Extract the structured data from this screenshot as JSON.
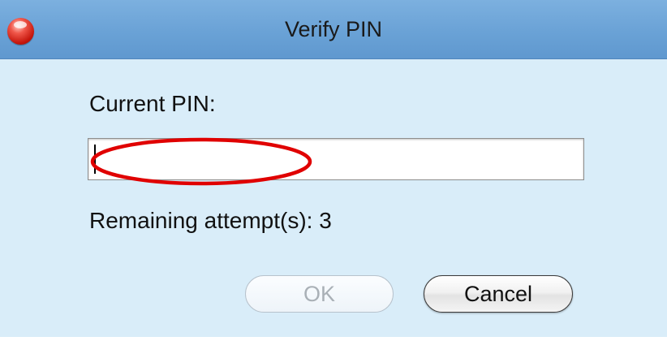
{
  "window": {
    "title": "Verify PIN"
  },
  "form": {
    "pin_label": "Current PIN:",
    "pin_value": "",
    "attempts_text": "Remaining attempt(s): 3"
  },
  "buttons": {
    "ok_label": "OK",
    "cancel_label": "Cancel"
  },
  "annotation": {
    "highlight_color": "#e00000"
  }
}
